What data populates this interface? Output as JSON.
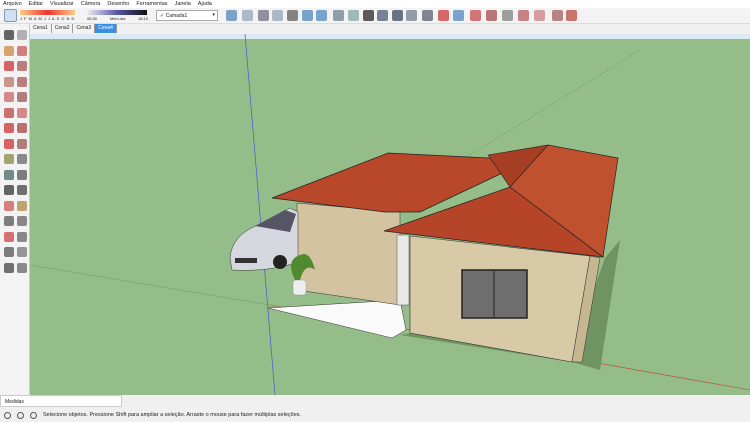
{
  "menu": [
    "Arquivo",
    "Editar",
    "Visualizar",
    "Câmera",
    "Desenho",
    "Ferramentas",
    "Janela",
    "Ajuda"
  ],
  "shadow": {
    "months": "J F M A M J J A S O N D",
    "time_start": "06:30",
    "time_mid": "Meio-dia",
    "time_end": "18:10"
  },
  "layer": {
    "selected": "Camada1",
    "check": "✓"
  },
  "tabs": [
    "Cena1",
    "Cena2",
    "Cena3",
    "Cena4"
  ],
  "active_tab": "Cena4",
  "measure_label": "Medidas",
  "status_text": "Selecione objetos. Pressione Shift para ampliar a seleção. Arraste o mouse para fazer múltiplas seleções.",
  "colors": {
    "roof": "#b9472a",
    "wall": "#d8c9a7",
    "ground": "#95bd89",
    "accent": "#3b8fe0"
  }
}
